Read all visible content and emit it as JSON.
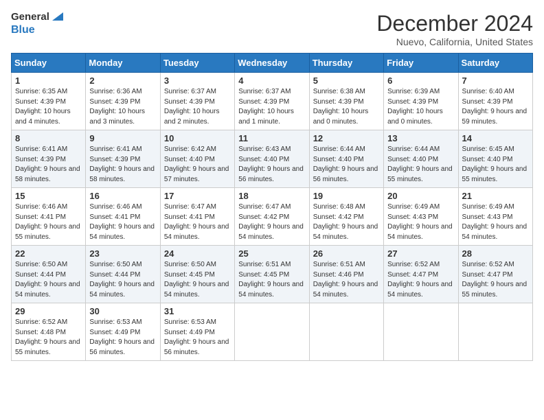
{
  "header": {
    "logo_line1": "General",
    "logo_line2": "Blue",
    "month": "December 2024",
    "location": "Nuevo, California, United States"
  },
  "days_of_week": [
    "Sunday",
    "Monday",
    "Tuesday",
    "Wednesday",
    "Thursday",
    "Friday",
    "Saturday"
  ],
  "weeks": [
    [
      {
        "day": 1,
        "sunrise": "6:35 AM",
        "sunset": "4:39 PM",
        "daylight": "10 hours and 4 minutes."
      },
      {
        "day": 2,
        "sunrise": "6:36 AM",
        "sunset": "4:39 PM",
        "daylight": "10 hours and 3 minutes."
      },
      {
        "day": 3,
        "sunrise": "6:37 AM",
        "sunset": "4:39 PM",
        "daylight": "10 hours and 2 minutes."
      },
      {
        "day": 4,
        "sunrise": "6:37 AM",
        "sunset": "4:39 PM",
        "daylight": "10 hours and 1 minute."
      },
      {
        "day": 5,
        "sunrise": "6:38 AM",
        "sunset": "4:39 PM",
        "daylight": "10 hours and 0 minutes."
      },
      {
        "day": 6,
        "sunrise": "6:39 AM",
        "sunset": "4:39 PM",
        "daylight": "10 hours and 0 minutes."
      },
      {
        "day": 7,
        "sunrise": "6:40 AM",
        "sunset": "4:39 PM",
        "daylight": "9 hours and 59 minutes."
      }
    ],
    [
      {
        "day": 8,
        "sunrise": "6:41 AM",
        "sunset": "4:39 PM",
        "daylight": "9 hours and 58 minutes."
      },
      {
        "day": 9,
        "sunrise": "6:41 AM",
        "sunset": "4:39 PM",
        "daylight": "9 hours and 58 minutes."
      },
      {
        "day": 10,
        "sunrise": "6:42 AM",
        "sunset": "4:40 PM",
        "daylight": "9 hours and 57 minutes."
      },
      {
        "day": 11,
        "sunrise": "6:43 AM",
        "sunset": "4:40 PM",
        "daylight": "9 hours and 56 minutes."
      },
      {
        "day": 12,
        "sunrise": "6:44 AM",
        "sunset": "4:40 PM",
        "daylight": "9 hours and 56 minutes."
      },
      {
        "day": 13,
        "sunrise": "6:44 AM",
        "sunset": "4:40 PM",
        "daylight": "9 hours and 55 minutes."
      },
      {
        "day": 14,
        "sunrise": "6:45 AM",
        "sunset": "4:40 PM",
        "daylight": "9 hours and 55 minutes."
      }
    ],
    [
      {
        "day": 15,
        "sunrise": "6:46 AM",
        "sunset": "4:41 PM",
        "daylight": "9 hours and 55 minutes."
      },
      {
        "day": 16,
        "sunrise": "6:46 AM",
        "sunset": "4:41 PM",
        "daylight": "9 hours and 54 minutes."
      },
      {
        "day": 17,
        "sunrise": "6:47 AM",
        "sunset": "4:41 PM",
        "daylight": "9 hours and 54 minutes."
      },
      {
        "day": 18,
        "sunrise": "6:47 AM",
        "sunset": "4:42 PM",
        "daylight": "9 hours and 54 minutes."
      },
      {
        "day": 19,
        "sunrise": "6:48 AM",
        "sunset": "4:42 PM",
        "daylight": "9 hours and 54 minutes."
      },
      {
        "day": 20,
        "sunrise": "6:49 AM",
        "sunset": "4:43 PM",
        "daylight": "9 hours and 54 minutes."
      },
      {
        "day": 21,
        "sunrise": "6:49 AM",
        "sunset": "4:43 PM",
        "daylight": "9 hours and 54 minutes."
      }
    ],
    [
      {
        "day": 22,
        "sunrise": "6:50 AM",
        "sunset": "4:44 PM",
        "daylight": "9 hours and 54 minutes."
      },
      {
        "day": 23,
        "sunrise": "6:50 AM",
        "sunset": "4:44 PM",
        "daylight": "9 hours and 54 minutes."
      },
      {
        "day": 24,
        "sunrise": "6:50 AM",
        "sunset": "4:45 PM",
        "daylight": "9 hours and 54 minutes."
      },
      {
        "day": 25,
        "sunrise": "6:51 AM",
        "sunset": "4:45 PM",
        "daylight": "9 hours and 54 minutes."
      },
      {
        "day": 26,
        "sunrise": "6:51 AM",
        "sunset": "4:46 PM",
        "daylight": "9 hours and 54 minutes."
      },
      {
        "day": 27,
        "sunrise": "6:52 AM",
        "sunset": "4:47 PM",
        "daylight": "9 hours and 54 minutes."
      },
      {
        "day": 28,
        "sunrise": "6:52 AM",
        "sunset": "4:47 PM",
        "daylight": "9 hours and 55 minutes."
      }
    ],
    [
      {
        "day": 29,
        "sunrise": "6:52 AM",
        "sunset": "4:48 PM",
        "daylight": "9 hours and 55 minutes."
      },
      {
        "day": 30,
        "sunrise": "6:53 AM",
        "sunset": "4:49 PM",
        "daylight": "9 hours and 56 minutes."
      },
      {
        "day": 31,
        "sunrise": "6:53 AM",
        "sunset": "4:49 PM",
        "daylight": "9 hours and 56 minutes."
      },
      null,
      null,
      null,
      null
    ]
  ]
}
